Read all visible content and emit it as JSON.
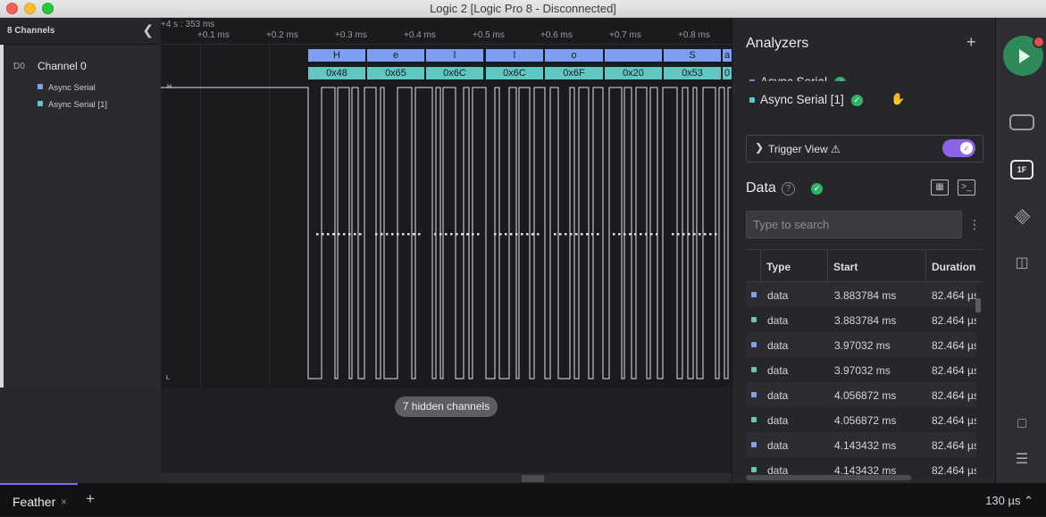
{
  "window": {
    "title": "Logic 2 [Logic Pro 8 - Disconnected]"
  },
  "sidebar": {
    "header": "8 Channels",
    "channel": {
      "id": "D0",
      "name": "Channel 0"
    },
    "analyzers": [
      {
        "name": "Async Serial",
        "color": "#7d9ff1"
      },
      {
        "name": "Async Serial [1]",
        "color": "#62c7c2"
      }
    ]
  },
  "waveform": {
    "time_origin": "+4 s : 353 ms",
    "ticks": [
      "+0.1 ms",
      "+0.2 ms",
      "+0.3 ms",
      "+0.4 ms",
      "+0.5 ms",
      "+0.6 ms",
      "+0.7 ms",
      "+0.8 ms"
    ],
    "high_marker": "H",
    "low_marker": "L",
    "decode_chars": [
      "H",
      "e",
      "l",
      "l",
      "o",
      "",
      "S",
      "a"
    ],
    "decode_hex": [
      "0x48",
      "0x65",
      "0x6C",
      "0x6C",
      "0x6F",
      "0x20",
      "0x53",
      "0"
    ]
  },
  "hidden_channels": "7 hidden channels",
  "analyzers_panel": {
    "title": "Analyzers",
    "items": [
      {
        "name": "Async Serial",
        "color": "#7d9ff1"
      },
      {
        "name": "Async Serial [1]",
        "color": "#62c7c2"
      }
    ],
    "trigger_view": "Trigger View"
  },
  "data_panel": {
    "title": "Data",
    "search_placeholder": "Type to search",
    "columns": [
      "Type",
      "Start",
      "Duration"
    ],
    "rows": [
      {
        "type": "data",
        "start": "3.883784 ms",
        "duration": "82.464 µs",
        "color": "#7d9ff1"
      },
      {
        "type": "data",
        "start": "3.883784 ms",
        "duration": "82.464 µs",
        "color": "#62c7c2"
      },
      {
        "type": "data",
        "start": "3.97032 ms",
        "duration": "82.464 µs",
        "color": "#7d9ff1"
      },
      {
        "type": "data",
        "start": "3.97032 ms",
        "duration": "82.464 µs",
        "color": "#62c7c2"
      },
      {
        "type": "data",
        "start": "4.056872 ms",
        "duration": "82.464 µs",
        "color": "#7d9ff1"
      },
      {
        "type": "data",
        "start": "4.056872 ms",
        "duration": "82.464 µs",
        "color": "#62c7c2"
      },
      {
        "type": "data",
        "start": "4.143432 ms",
        "duration": "82.464 µs",
        "color": "#7d9ff1"
      },
      {
        "type": "data",
        "start": "4.143432 ms",
        "duration": "82.464 µs",
        "color": "#62c7c2"
      }
    ]
  },
  "rail": {
    "device_tag": "1F"
  },
  "bottom_bar": {
    "tab": "Feather",
    "tab_close": "×",
    "add_tab": "+",
    "zoom": "130 µs ⌃"
  }
}
